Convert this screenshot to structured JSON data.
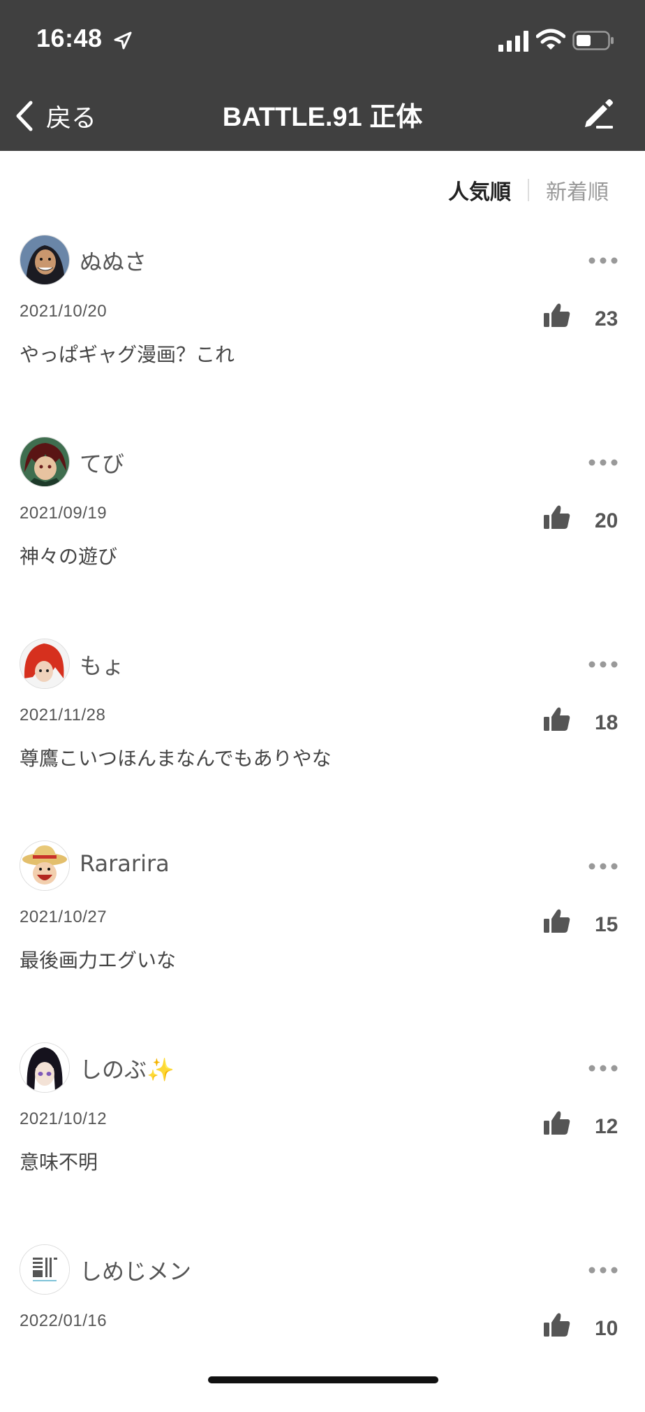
{
  "status_bar": {
    "time": "16:48"
  },
  "nav": {
    "back_label": "戻る",
    "title": "BATTLE.91 正体"
  },
  "sort": {
    "popular": "人気順",
    "newest": "新着順"
  },
  "comments": [
    {
      "user": "ぬぬさ",
      "date": "2021/10/20",
      "likes": "23",
      "text": "やっぱギャグ漫画？これ",
      "avatar": "avatar-dark-hair"
    },
    {
      "user": "てび",
      "date": "2021/09/19",
      "likes": "20",
      "text": "神々の遊び",
      "avatar": "avatar-red-hair"
    },
    {
      "user": "もょ",
      "date": "2021/11/28",
      "likes": "18",
      "text": "尊鷹こいつほんまなんでもありやな",
      "avatar": "avatar-red-character"
    },
    {
      "user": "Rararira",
      "date": "2021/10/27",
      "likes": "15",
      "text": "最後画力エグいな",
      "avatar": "avatar-straw-hat"
    },
    {
      "user": "しのぶ✨",
      "date": "2021/10/12",
      "likes": "12",
      "text": "意味不明",
      "avatar": "avatar-purple-eyes"
    },
    {
      "user": "しめじメン",
      "date": "2022/01/16",
      "likes": "10",
      "text": "",
      "avatar": "avatar-logo"
    }
  ],
  "colors": {
    "header_bg": "#404040",
    "text": "#444444",
    "muted": "#999999"
  }
}
